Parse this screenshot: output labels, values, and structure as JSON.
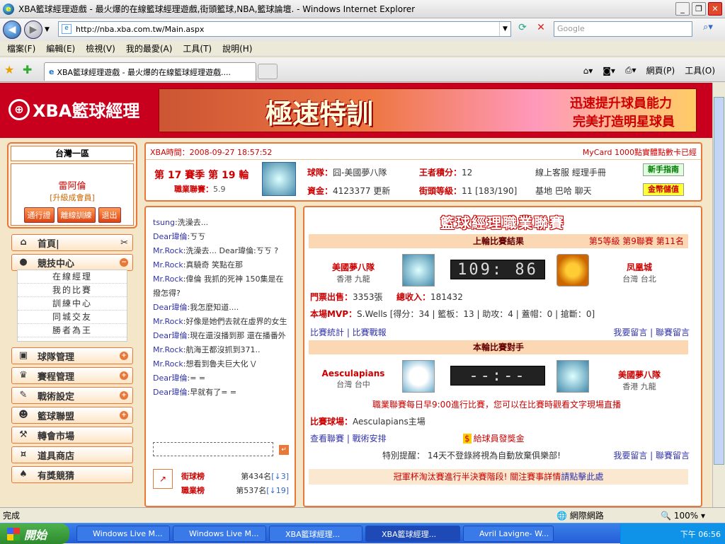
{
  "window": {
    "title": "XBA籃球經理遊戲 - 最火爆的在線籃球經理遊戲,街頭籃球,NBA,籃球論壇. - Windows Internet Explorer"
  },
  "address": {
    "url": "http://nba.xba.com.tw/Main.aspx",
    "search_placeholder": "Google"
  },
  "menu": [
    "檔案(F)",
    "編輯(E)",
    "檢視(V)",
    "我的最愛(A)",
    "工具(T)",
    "說明(H)"
  ],
  "tab": {
    "label": "XBA籃球經理遊戲 - 最火爆的在線籃球經理遊戲...."
  },
  "toolbar": {
    "page": "網頁(P)",
    "tools": "工具(O)"
  },
  "site": {
    "logo": "XBA籃球經理",
    "banner_main": "極速特訓",
    "banner_sub1": "迅速提升球員能力",
    "banner_sub2": "完美打造明星球員"
  },
  "user": {
    "region": "台灣一區",
    "name": "雷阿倫",
    "level": "[升級成會員]",
    "btn1": "通行證",
    "btn2": "離線訓練",
    "btn3": "退出"
  },
  "nav": {
    "home": "首頁|",
    "arena": "競技中心",
    "sub": [
      "在線經理",
      "我的比賽",
      "訓練中心",
      "同城交友",
      "勝者為王"
    ],
    "team": "球隊管理",
    "schedule": "賽程管理",
    "tactics": "戰術設定",
    "alliance": "籃球聯盟",
    "transfer": "轉會市場",
    "shop": "道具商店",
    "lottery": "有獎競猜"
  },
  "info": {
    "time": "XBA時間：2008-09-27 18:57:52",
    "mycard": "MyCard 1000點實體點數卡已經",
    "season": "第 17 賽季 第 19 輪",
    "league_label": "職業聯賽：",
    "league_val": "5.9",
    "team_label": "球隊：",
    "team_val": "囧-美國夢八隊",
    "kp_label": "王者積分：",
    "kp_val": "12",
    "online": "線上客服  經理手冊",
    "funds_label": "資金：",
    "funds_val": "4123377 更新",
    "street_label": "街頭等級：",
    "street_val": "11 [183/190]",
    "base": "基地  巴哈  聊天",
    "guide": "新手指南",
    "gold": "金幣儲值"
  },
  "chat": [
    {
      "who": "tsung",
      "msg": ":洗澡去..."
    },
    {
      "who": "Dear瑋倫",
      "msg": ":ㄎㄎ"
    },
    {
      "who": "Mr.Rock",
      "msg": ":洗澡去...    Dear瑋倫:ㄎㄎ ?"
    },
    {
      "who": "Mr.Rock",
      "msg": ":真驍奇    笑點在那"
    },
    {
      "who": "Mr.Rock",
      "msg": ":偉倫    我抓的死神    150集是在撥怎得?"
    },
    {
      "who": "Dear瑋倫",
      "msg": ":我怎麼知道...."
    },
    {
      "who": "Mr.Rock",
      "msg": ":好像是她們去就在虛界的女生"
    },
    {
      "who": "Dear瑋倫",
      "msg": ":現在還沒播到那  還在播番外"
    },
    {
      "who": "Mr.Rock",
      "msg": ":航海王都沒抓到371.."
    },
    {
      "who": "Mr.Rock",
      "msg": ":想看到魯夫巨大化 \\/"
    },
    {
      "who": "Dear瑋倫",
      "msg": ":= ="
    },
    {
      "who": "Dear瑋倫",
      "msg": ":早就有了= ="
    }
  ],
  "rank": {
    "street_label": "街球榜",
    "street_val": "第434名",
    "street_chg": "[↓3]",
    "pro_label": "職業榜",
    "pro_val": "第537名",
    "pro_chg": "[↓19]"
  },
  "league": {
    "title": "籃球經理職業聯賽",
    "last_title": "上輪比賽結果",
    "last_rt": "第5等級  第9聯賽  第11名",
    "home_team": "美國夢八隊",
    "home_city": "香港 九龍",
    "score": "109: 86",
    "away_team": "凤凰城",
    "away_city": "台灣 台北",
    "tickets_label": "門票出售：",
    "tickets_val": "3353張",
    "income_label": "總收入：",
    "income_val": "181432",
    "mvp_label": "本場MVP：",
    "mvp_val": "S.Wells [得分：34 | 籃板：13 | 助攻：4 | 蓋帽：0 | 搶斷：0]",
    "stats_link": "比賽統計 | 比賽戰報",
    "msg_link1": "我要留言 | 聯賽留言",
    "next_title": "本輪比賽對手",
    "opp_team": "Aesculapians",
    "opp_city": "台灣 台中",
    "next_score": "--:--",
    "my_team": "美國夢八隊",
    "my_city": "香港 九龍",
    "daily": "職業聯賽每日早9:00進行比賽，您可以在比賽時觀看文字現場直播",
    "venue_label": "比賽球場：",
    "venue_val": "Aesculapians主場",
    "view_link": "查看聯賽 | 戰術安排",
    "bonus": "給球員發獎金",
    "remind": "特別提醒：  14天不登錄將視為自動放棄俱樂部!",
    "msg_link2": "我要留言 | 聯賽留言",
    "cup": "冠軍杯淘汰賽進行半決賽階段! 關注賽事詳情",
    "cup_link": "請點擊此處"
  },
  "status": {
    "text": "完成",
    "zone": "網際網路",
    "zoom": "100%"
  },
  "taskbar": {
    "start": "開始",
    "items": [
      "Windows Live M...",
      "Windows Live M...",
      "XBA籃球經理...",
      "XBA籃球經理...",
      "Avril Lavigne- W..."
    ],
    "clock": "下午 06:56"
  }
}
